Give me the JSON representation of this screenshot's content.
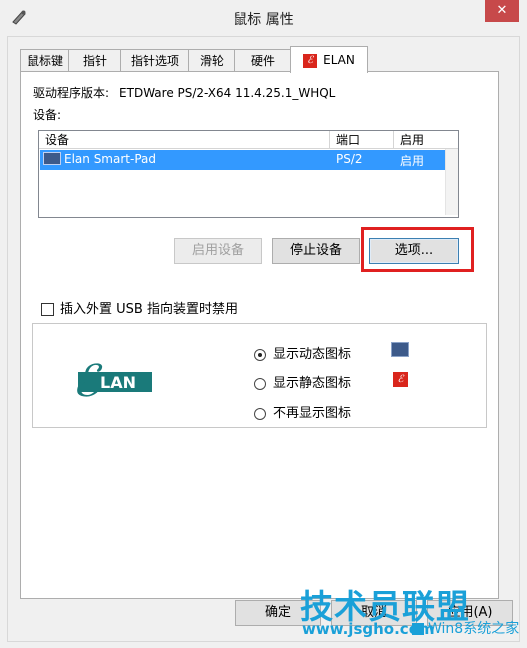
{
  "window": {
    "title": "鼠标 属性",
    "close_glyph": "✕",
    "app_icon": "mouse-icon"
  },
  "tabs": [
    {
      "label": "鼠标键"
    },
    {
      "label": "指针"
    },
    {
      "label": "指针选项"
    },
    {
      "label": "滑轮"
    },
    {
      "label": "硬件"
    },
    {
      "label": "ELAN",
      "icon_glyph": "ℰ",
      "active": true
    }
  ],
  "driver": {
    "label": "驱动程序版本:",
    "value": "ETDWare PS/2-X64 11.4.25.1_WHQL"
  },
  "devices": {
    "label": "设备:",
    "columns": [
      "设备",
      "端口",
      "启用"
    ],
    "rows": [
      {
        "name": "Elan Smart-Pad",
        "port": "PS/2",
        "enabled": "启用",
        "selected": true
      }
    ]
  },
  "buttons": {
    "enable": "启用设备",
    "stop": "停止设备",
    "options": "选项..."
  },
  "checkbox": {
    "label": "插入外置 USB 指向装置时禁用",
    "checked": false
  },
  "logo": {
    "text": "LAN",
    "script": "ℰ"
  },
  "tray_icon_options": [
    {
      "label": "显示动态图标",
      "selected": true,
      "icon": "touchpad-icon"
    },
    {
      "label": "显示静态图标",
      "selected": false,
      "icon": "elan-logo-icon",
      "glyph": "ℰ"
    },
    {
      "label": "不再显示图标",
      "selected": false
    }
  ],
  "dialog": {
    "ok": "确定",
    "cancel": "取消",
    "apply": "应用(A)"
  },
  "watermark": {
    "title": "技术员联盟",
    "url": "www.jsgho.com",
    "subtitle": "Win8系统之家"
  },
  "colors": {
    "selection": "#3399ff",
    "highlight": "#e02020",
    "elan_red": "#d9261c",
    "elan_teal": "#1a7a7a",
    "watermark": "#1aa0d8"
  }
}
